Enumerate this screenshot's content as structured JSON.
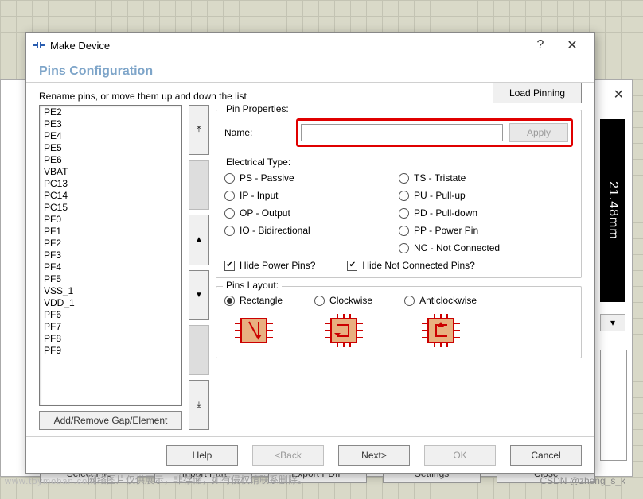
{
  "dialog": {
    "title": "Make Device",
    "subtitle": "Pins Configuration",
    "instruction": "Rename pins, or move them up and down the list",
    "load_pinning": "Load Pinning"
  },
  "pins": [
    "PE2",
    "PE3",
    "PE4",
    "PE5",
    "PE6",
    "VBAT",
    "PC13",
    "PC14",
    "PC15",
    "PF0",
    "PF1",
    "PF2",
    "PF3",
    "PF4",
    "PF5",
    "VSS_1",
    "VDD_1",
    "PF6",
    "PF7",
    "PF8",
    "PF9"
  ],
  "gap_btn": "Add/Remove Gap/Element",
  "pin_props": {
    "legend": "Pin Properties:",
    "name_label": "Name:",
    "name_value": "",
    "apply": "Apply",
    "etype_label": "Electrical Type:",
    "etype_left": [
      {
        "code": "PS",
        "label": "PS - Passive"
      },
      {
        "code": "IP",
        "label": "IP - Input"
      },
      {
        "code": "OP",
        "label": "OP - Output"
      },
      {
        "code": "IO",
        "label": "IO - Bidirectional"
      }
    ],
    "etype_right": [
      {
        "code": "TS",
        "label": "TS - Tristate"
      },
      {
        "code": "PU",
        "label": "PU - Pull-up"
      },
      {
        "code": "PD",
        "label": "PD - Pull-down"
      },
      {
        "code": "PP",
        "label": "PP - Power Pin"
      },
      {
        "code": "NC",
        "label": "NC - Not Connected"
      }
    ],
    "hide_power": "Hide Power Pins?",
    "hide_nc": "Hide Not Connected Pins?",
    "hide_power_checked": true,
    "hide_nc_checked": true
  },
  "pins_layout": {
    "legend": "Pins Layout:",
    "options": [
      "Rectangle",
      "Clockwise",
      "Anticlockwise"
    ],
    "selected": "Rectangle"
  },
  "footer": {
    "help": "Help",
    "back": "<Back",
    "next": "Next>",
    "ok": "OK",
    "cancel": "Cancel"
  },
  "back_window": {
    "buttons": [
      "Select File",
      "Import Part",
      "Export PDIF",
      "Settings",
      "Close"
    ],
    "measure": "21.48mm",
    "dropdown_arrow": "▾"
  },
  "watermarks": {
    "left_site": "www.toymoban.com",
    "left_text": "网络图片仅供展示，非存储，如有侵权请联系删除。",
    "right": "CSDN @zheng_s_k"
  }
}
